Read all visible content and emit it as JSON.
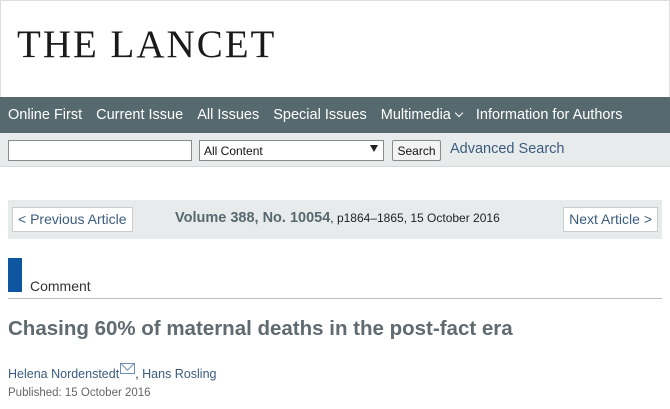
{
  "masthead": {
    "logo_text": "THE LANCET"
  },
  "nav": {
    "items": [
      {
        "label": "Online First"
      },
      {
        "label": "Current Issue"
      },
      {
        "label": "All Issues"
      },
      {
        "label": "Special Issues"
      },
      {
        "label": "Multimedia",
        "icon": "chevron-down-icon"
      },
      {
        "label": "Information for Authors"
      }
    ]
  },
  "search": {
    "input_value": "",
    "scope_selected": "All Content",
    "button_label": "Search",
    "advanced_label": "Advanced Search"
  },
  "article_nav": {
    "prev_label": "< Previous Article",
    "next_label": "Next Article >",
    "volume": "Volume 388, No. 10054",
    "details": ", p1864–1865, 15 October 2016"
  },
  "article": {
    "section": "Comment",
    "title": "Chasing 60% of maternal deaths in the post-fact era",
    "authors": [
      "Helena Nordenstedt",
      "Hans Rosling"
    ],
    "author_separator": ", ",
    "published": "Published: 15 October 2016"
  },
  "colors": {
    "nav_bg": "#55696f",
    "link": "#3b5c7e",
    "section_marker": "#0e56a0",
    "title": "#5f6b70"
  }
}
